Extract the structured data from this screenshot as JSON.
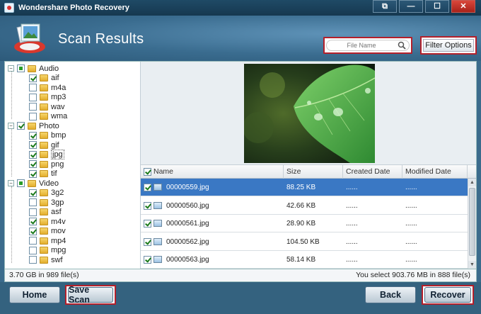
{
  "window": {
    "title": "Wondershare Photo Recovery",
    "buttons": {
      "restore": "⧉",
      "minimize": "—",
      "maximize": "☐",
      "close": "✕"
    }
  },
  "header": {
    "title": "Scan Results",
    "search_placeholder": "File Name",
    "filter_label": "Filter Options"
  },
  "tree": {
    "groups": [
      {
        "label": "Audio",
        "state": "partial",
        "items": [
          {
            "label": "aif",
            "checked": true
          },
          {
            "label": "m4a",
            "checked": false
          },
          {
            "label": "mp3",
            "checked": false
          },
          {
            "label": "wav",
            "checked": false
          },
          {
            "label": "wma",
            "checked": false
          }
        ]
      },
      {
        "label": "Photo",
        "state": "checked",
        "items": [
          {
            "label": "bmp",
            "checked": true
          },
          {
            "label": "gif",
            "checked": true
          },
          {
            "label": "jpg",
            "checked": true
          },
          {
            "label": "png",
            "checked": true
          },
          {
            "label": "tif",
            "checked": true
          }
        ]
      },
      {
        "label": "Video",
        "state": "partial",
        "items": [
          {
            "label": "3g2",
            "checked": true
          },
          {
            "label": "3gp",
            "checked": false
          },
          {
            "label": "asf",
            "checked": false
          },
          {
            "label": "m4v",
            "checked": true
          },
          {
            "label": "mov",
            "checked": true
          },
          {
            "label": "mp4",
            "checked": false
          },
          {
            "label": "mpg",
            "checked": false
          },
          {
            "label": "swf",
            "checked": false
          }
        ]
      }
    ]
  },
  "table": {
    "columns": [
      "Name",
      "Size",
      "Created Date",
      "Modified Date"
    ],
    "rows": [
      {
        "name": "00000559.jpg",
        "size": "88.25 KB",
        "created": "......",
        "modified": "......",
        "selected": true
      },
      {
        "name": "00000560.jpg",
        "size": "42.66 KB",
        "created": "......",
        "modified": "......",
        "selected": false
      },
      {
        "name": "00000561.jpg",
        "size": "28.90 KB",
        "created": "......",
        "modified": "......",
        "selected": false
      },
      {
        "name": "00000562.jpg",
        "size": "104.50 KB",
        "created": "......",
        "modified": "......",
        "selected": false
      },
      {
        "name": "00000563.jpg",
        "size": "58.14 KB",
        "created": "......",
        "modified": "......",
        "selected": false
      }
    ]
  },
  "status": {
    "left": "3.70 GB in 989 file(s)",
    "right": "You select 903.76 MB in 888 file(s)"
  },
  "footer": {
    "home": "Home",
    "save_scan": "Save Scan",
    "back": "Back",
    "recover": "Recover"
  },
  "colors": {
    "accent_red": "#b3202b",
    "selection_blue": "#3a78c4",
    "frame_blue": "#3b6b8c"
  }
}
